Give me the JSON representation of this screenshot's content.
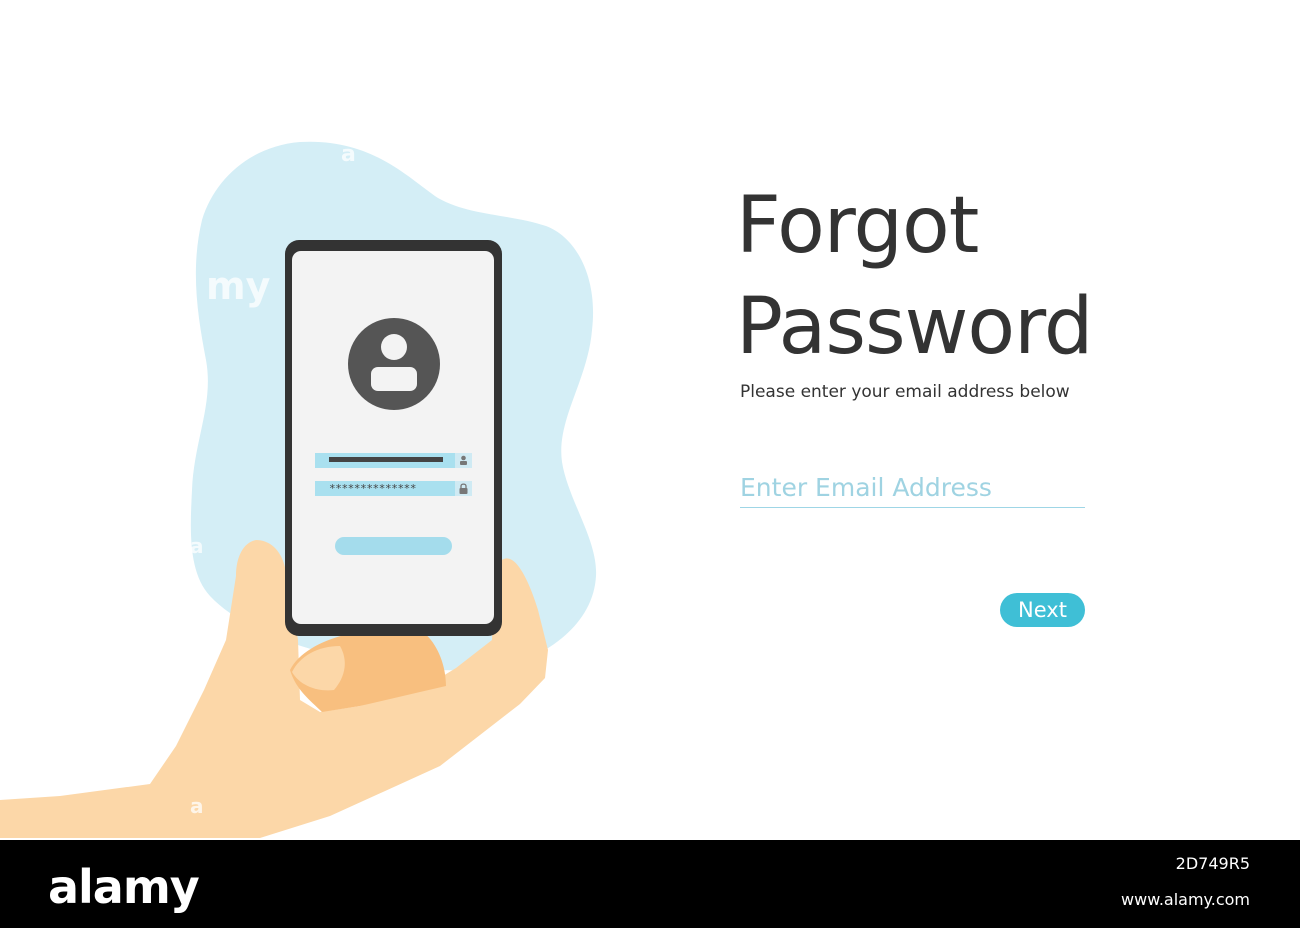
{
  "heading": {
    "line1": "Forgot",
    "line2": "Password"
  },
  "subtitle": "Please enter your email address below",
  "email_field": {
    "placeholder": "Enter Email Address",
    "value": ""
  },
  "next_button": {
    "label": "Next"
  },
  "phone_mock": {
    "password_mask": "**************",
    "avatar_icon": "user-icon",
    "user_field_icon": "user-icon",
    "password_field_icon": "lock-icon"
  },
  "watermark": {
    "marks": [
      "a",
      "my",
      "a",
      "a"
    ]
  },
  "footer": {
    "logo": "alamy",
    "image_id": "2D749R5",
    "url": "www.alamy.com"
  },
  "colors": {
    "accent": "#3fbfd6",
    "blob": "#d4eef6",
    "skin": "#fcd7a8",
    "skin_shadow": "#f8bf7f",
    "phone_frame": "#333333",
    "phone_screen": "#f3f3f3",
    "text": "#333333",
    "placeholder": "#9fd3e2"
  }
}
